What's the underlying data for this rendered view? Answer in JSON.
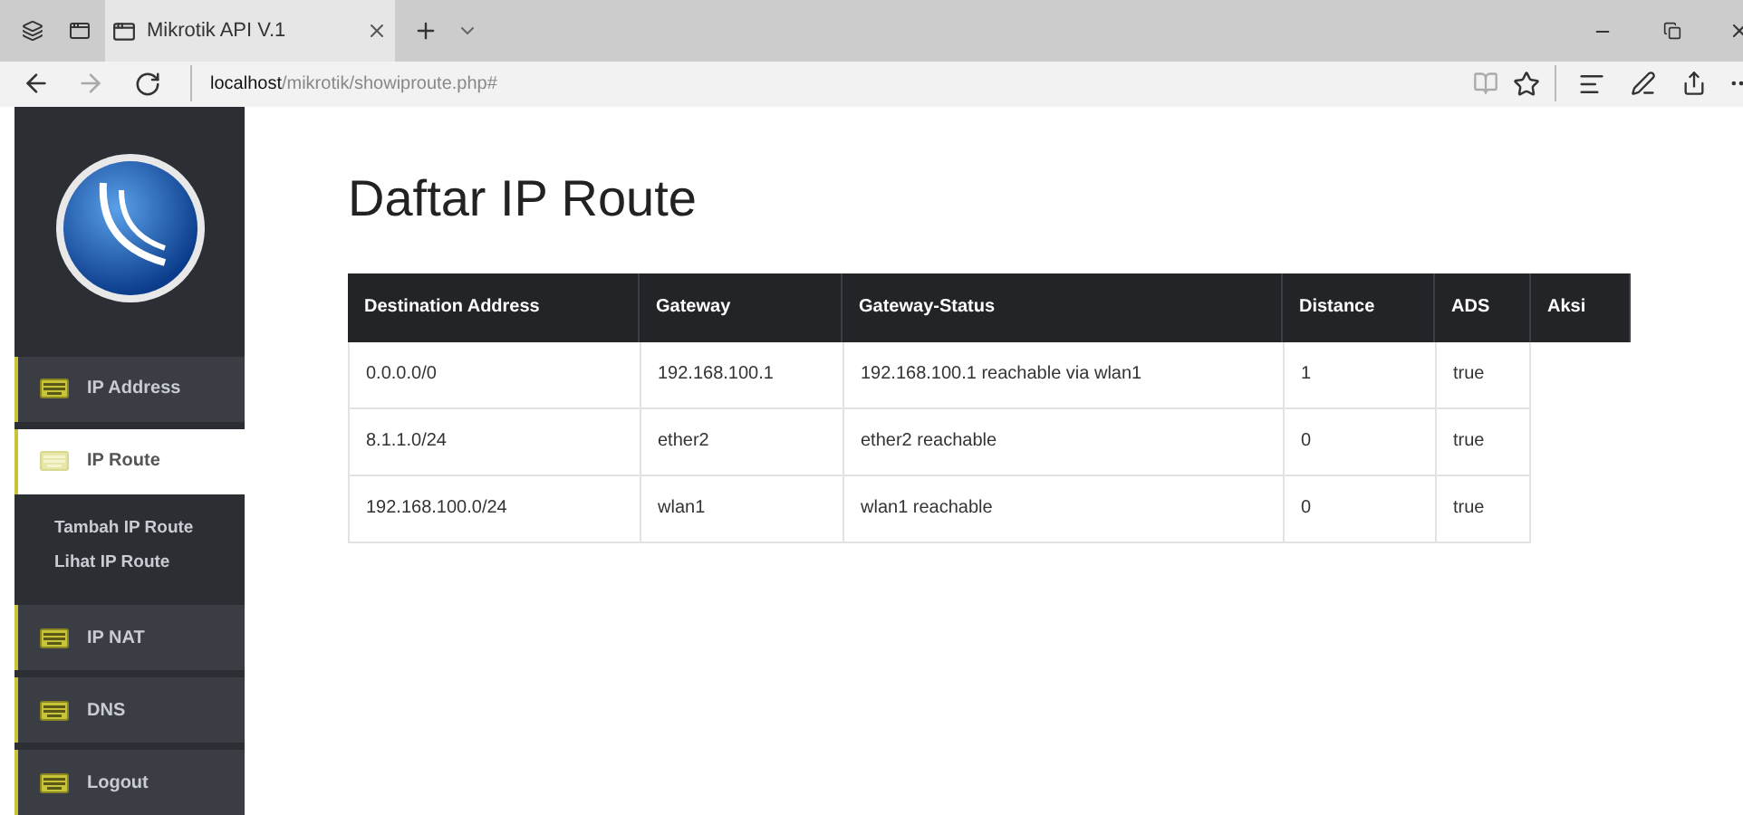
{
  "browser": {
    "tab_title": "Mikrotik API V.1",
    "url_host": "localhost",
    "url_path": "/mikrotik/showiproute.php#"
  },
  "sidebar": {
    "items": [
      {
        "label": "IP Address",
        "selected": false
      },
      {
        "label": "IP Route",
        "selected": true,
        "children": [
          {
            "label": "Tambah IP Route"
          },
          {
            "label": "Lihat IP Route"
          }
        ]
      },
      {
        "label": "IP NAT",
        "selected": false
      },
      {
        "label": "DNS",
        "selected": false
      },
      {
        "label": "Logout",
        "selected": false
      }
    ]
  },
  "page": {
    "title": "Daftar IP Route"
  },
  "table": {
    "columns": [
      "Destination Address",
      "Gateway",
      "Gateway-Status",
      "Distance",
      "ADS",
      "Aksi"
    ],
    "rows": [
      [
        "0.0.0.0/0",
        "192.168.100.1",
        "192.168.100.1 reachable via wlan1",
        "1",
        "true"
      ],
      [
        "8.1.1.0/24",
        "ether2",
        "ether2 reachable",
        "0",
        "true"
      ],
      [
        "192.168.100.0/24",
        "wlan1",
        "wlan1 reachable",
        "0",
        "true"
      ]
    ]
  }
}
